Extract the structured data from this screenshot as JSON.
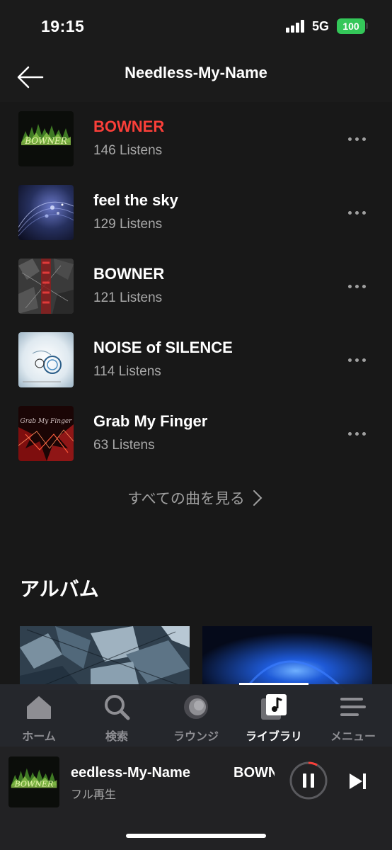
{
  "status_bar": {
    "time": "19:15",
    "network": "5G",
    "battery": "100"
  },
  "header": {
    "title": "Needless-My-Name"
  },
  "tracks": [
    {
      "title": "BOWNER",
      "listens": "146 Listens",
      "playing": true,
      "art_text": "BOWNER"
    },
    {
      "title": "feel the sky",
      "listens": "129 Listens",
      "playing": false
    },
    {
      "title": "BOWNER",
      "listens": "121 Listens",
      "playing": false
    },
    {
      "title": "NOISE of SILENCE",
      "listens": "114 Listens",
      "playing": false
    },
    {
      "title": "Grab My Finger",
      "listens": "63 Listens",
      "playing": false,
      "art_text": "Grab My Finger"
    }
  ],
  "see_all_label": "すべての曲を見る",
  "albums_section": {
    "title": "アルバム"
  },
  "tab_bar": {
    "tabs": [
      {
        "label": "ホーム",
        "icon": "home-icon",
        "active": false
      },
      {
        "label": "検索",
        "icon": "search-icon",
        "active": false
      },
      {
        "label": "ラウンジ",
        "icon": "lounge-icon",
        "active": false
      },
      {
        "label": "ライブラリ",
        "icon": "library-icon",
        "active": true
      },
      {
        "label": "メニュー",
        "icon": "menu-icon",
        "active": false
      }
    ]
  },
  "mini_player": {
    "title": "eedless-My-Name",
    "title_continuation": "BOWN",
    "subtitle": "フル再生",
    "art_text": "BOWNER",
    "progress": 0.08
  },
  "colors": {
    "accent": "#fa3f39",
    "background": "#181818",
    "battery": "#34c759"
  }
}
